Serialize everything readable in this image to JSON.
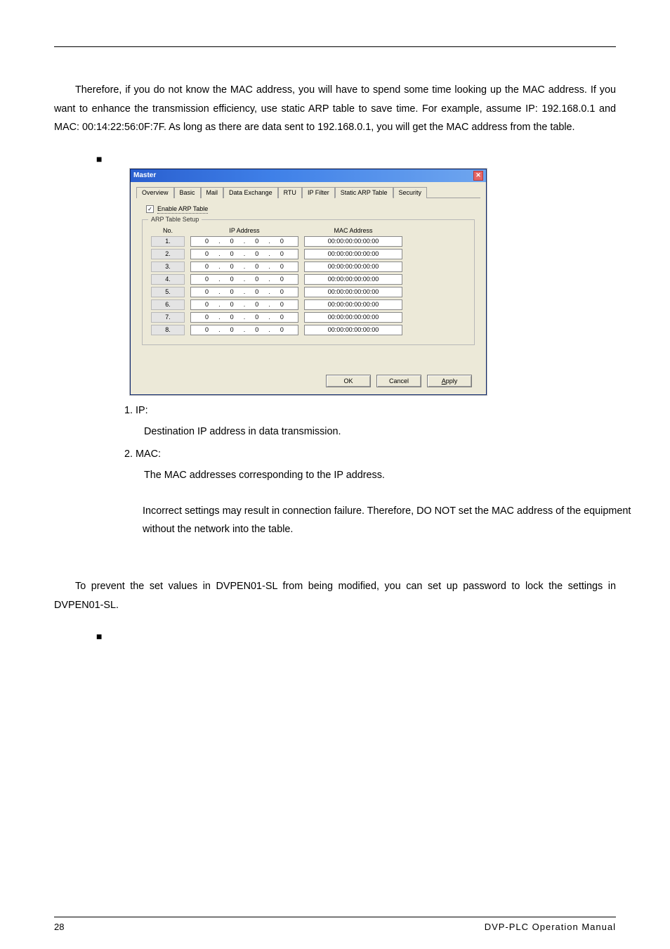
{
  "doc": {
    "intro_para": "Therefore, if you do not know the MAC address, you will have to spend some time looking up the MAC address. If you want to enhance the transmission efficiency, use static ARP table to save time. For example, assume IP: 192.168.0.1 and MAC: 00:14:22:56:0F:7F. As long as there are data sent to 192.168.0.1, you will get the MAC address from the table.",
    "bullet": "■",
    "definitions": [
      {
        "num": "1.",
        "term": "IP:",
        "text": "Destination IP address in data transmission."
      },
      {
        "num": "2.",
        "term": "MAC:",
        "text": "The MAC addresses corresponding to the IP address."
      }
    ],
    "warning": "Incorrect settings may result in connection failure. Therefore, DO NOT set the MAC address of the equipment without the network into the table.",
    "password_para": "To prevent the set values in DVPEN01-SL from being modified, you can set up password to lock the settings in DVPEN01-SL.",
    "page_num": "28",
    "footer_right": "DVP-PLC  Operation  Manual"
  },
  "dialog": {
    "title": "Master",
    "tabs": [
      "Overview",
      "Basic",
      "Mail",
      "Data Exchange",
      "RTU",
      "IP Filter",
      "Static ARP Table",
      "Security"
    ],
    "active_tab": 6,
    "checkbox_label": "Enable ARP Table",
    "group_title": "ARP Table Setup",
    "headers": {
      "no": "No.",
      "ip": "IP Address",
      "mac": "MAC Address"
    },
    "rows": [
      {
        "no": "1.",
        "ip": [
          "0",
          "0",
          "0",
          "0"
        ],
        "mac": "00:00:00:00:00:00"
      },
      {
        "no": "2.",
        "ip": [
          "0",
          "0",
          "0",
          "0"
        ],
        "mac": "00:00:00:00:00:00"
      },
      {
        "no": "3.",
        "ip": [
          "0",
          "0",
          "0",
          "0"
        ],
        "mac": "00:00:00:00:00:00"
      },
      {
        "no": "4.",
        "ip": [
          "0",
          "0",
          "0",
          "0"
        ],
        "mac": "00:00:00:00:00:00"
      },
      {
        "no": "5.",
        "ip": [
          "0",
          "0",
          "0",
          "0"
        ],
        "mac": "00:00:00:00:00:00"
      },
      {
        "no": "6.",
        "ip": [
          "0",
          "0",
          "0",
          "0"
        ],
        "mac": "00:00:00:00:00:00"
      },
      {
        "no": "7.",
        "ip": [
          "0",
          "0",
          "0",
          "0"
        ],
        "mac": "00:00:00:00:00:00"
      },
      {
        "no": "8.",
        "ip": [
          "0",
          "0",
          "0",
          "0"
        ],
        "mac": "00:00:00:00:00:00"
      }
    ],
    "buttons": {
      "ok": "OK",
      "cancel": "Cancel",
      "apply": "Apply",
      "apply_mn": "A"
    }
  }
}
